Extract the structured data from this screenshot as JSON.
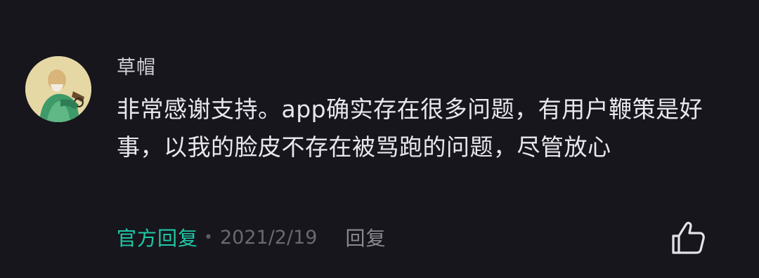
{
  "comment": {
    "author": "草帽",
    "text": "非常感谢支持。app确实存在很多问题，有用户鞭策是好事，以我的脸皮不存在被骂跑的问题，尽管放心",
    "badge": "官方回复",
    "separator": "•",
    "date": "2021/2/19",
    "reply_label": "回复"
  },
  "icons": {
    "avatar": "portrait-avatar",
    "like": "thumbs-up-icon"
  },
  "colors": {
    "background": "#17161d",
    "official_accent": "#20c9a6",
    "text": "#e8e8ec"
  }
}
